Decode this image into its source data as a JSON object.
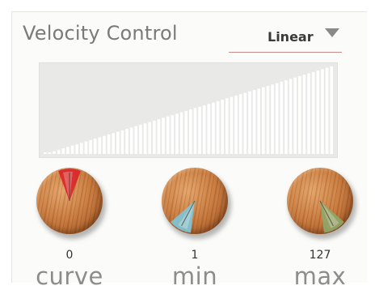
{
  "panel": {
    "title": "Velocity Control",
    "mode": {
      "selected": "Linear",
      "dropdown_icon": "triangle-down-icon"
    },
    "curve": {
      "type": "linear",
      "bar_count": 64,
      "min_fraction": 0.0,
      "max_fraction": 1.0,
      "bar_color": "#ffffff",
      "background_color": "#e9e9e8"
    },
    "knobs": [
      {
        "label": "curve",
        "value": "0",
        "indicator_color": "#d9252a",
        "indicator_angle": 0
      },
      {
        "label": "min",
        "value": "1",
        "indicator_color": "#7fc6d8",
        "indicator_angle": 208
      },
      {
        "label": "max",
        "value": "127",
        "indicator_color": "#8fa86a",
        "indicator_angle": 152
      }
    ]
  }
}
